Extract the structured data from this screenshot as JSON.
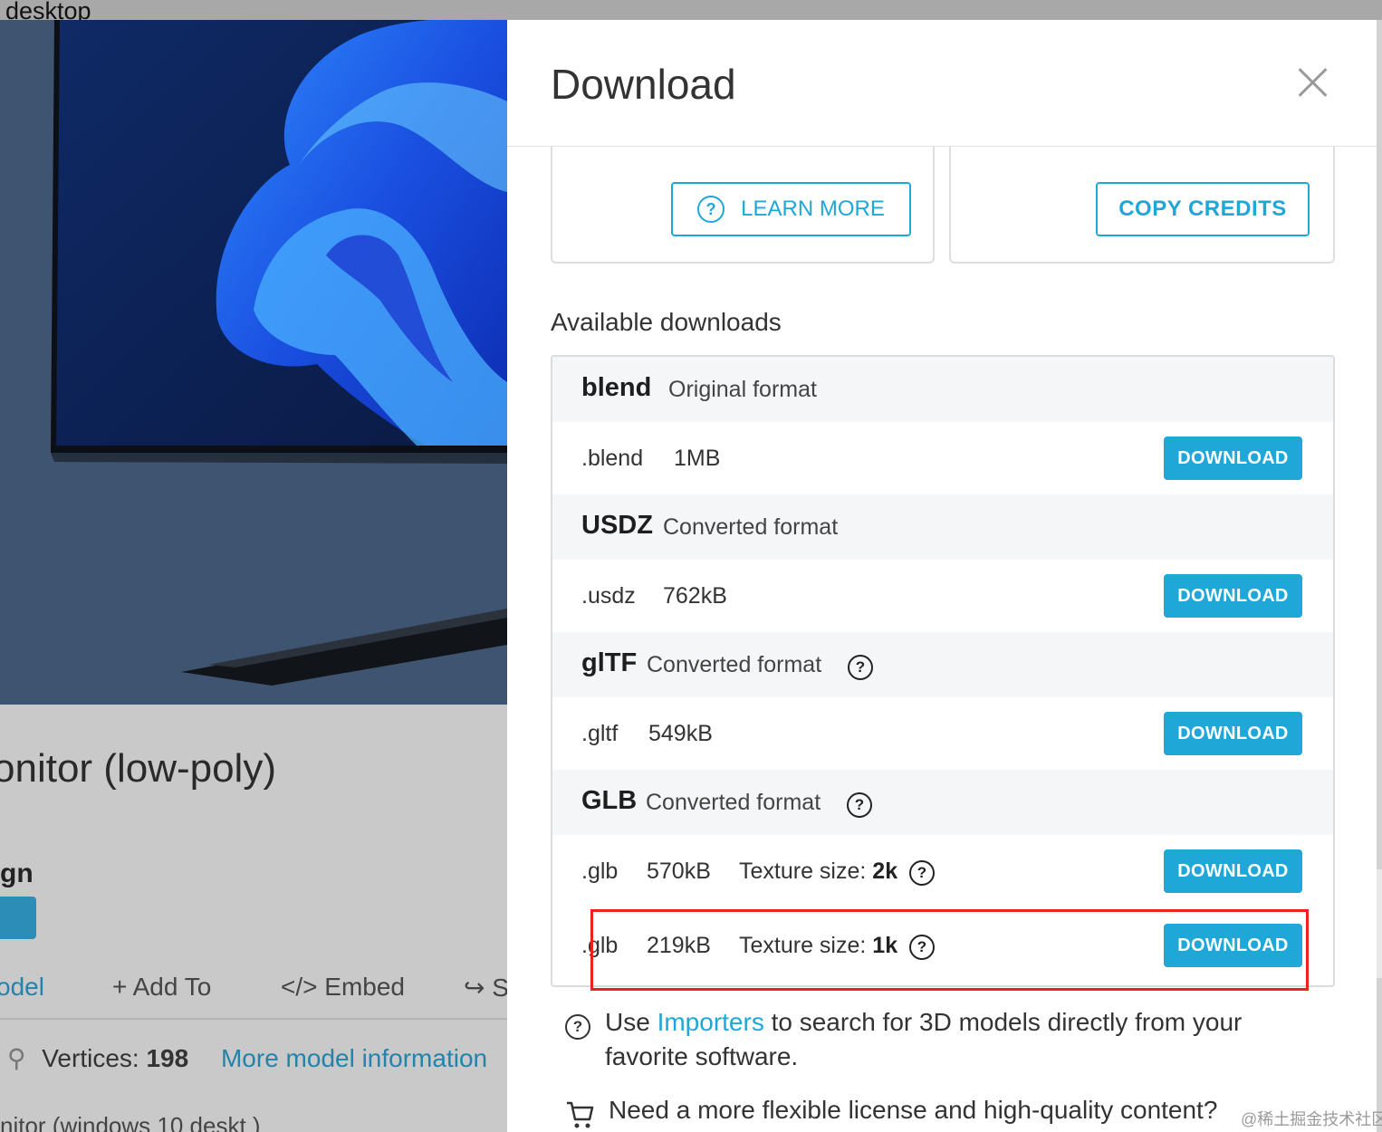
{
  "desktop_label": "desktop",
  "background_page": {
    "title": "onitor (low-poly)",
    "author": "gn",
    "actions": [
      {
        "label": "odel",
        "icon": "model-icon"
      },
      {
        "label": "Add To",
        "icon": "plus-icon"
      },
      {
        "label": "Embed",
        "icon": "code-icon"
      },
      {
        "label": "S",
        "icon": "share-icon"
      }
    ],
    "vertices_label": "Vertices:",
    "vertices_value": "198",
    "more_info_link": "More model information",
    "cut_text": "nitor (windows 10 deskt                )"
  },
  "modal": {
    "title": "Download",
    "learn_more_label": "LEARN MORE",
    "copy_credits_label": "COPY CREDITS",
    "available_title": "Available downloads",
    "formats": [
      {
        "name": "blend",
        "desc": "Original format",
        "has_help": false,
        "files": [
          {
            "ext": ".blend",
            "size": "1MB",
            "texture_label": "",
            "texture_value": "",
            "button": "DOWNLOAD"
          }
        ]
      },
      {
        "name": "USDZ",
        "desc": "Converted format",
        "has_help": false,
        "files": [
          {
            "ext": ".usdz",
            "size": "762kB",
            "texture_label": "",
            "texture_value": "",
            "button": "DOWNLOAD"
          }
        ]
      },
      {
        "name": "glTF",
        "desc": "Converted format",
        "has_help": true,
        "files": [
          {
            "ext": ".gltf",
            "size": "549kB",
            "texture_label": "",
            "texture_value": "",
            "button": "DOWNLOAD"
          }
        ]
      },
      {
        "name": "GLB",
        "desc": "Converted format",
        "has_help": true,
        "files": [
          {
            "ext": ".glb",
            "size": "570kB",
            "texture_label": "Texture size:",
            "texture_value": "2k",
            "button": "DOWNLOAD"
          },
          {
            "ext": ".glb",
            "size": "219kB",
            "texture_label": "Texture size:",
            "texture_value": "1k",
            "button": "DOWNLOAD"
          }
        ]
      }
    ],
    "importers_pre": "Use ",
    "importers_link": "Importers",
    "importers_post": " to search for 3D models directly from your favorite software.",
    "license_text": "Need a more flexible license and high-quality content?"
  },
  "watermark": "@稀土掘金技术社区",
  "colors": {
    "accent": "#1ea7d7",
    "highlight": "#f02020",
    "viewer_bg": "#3e5470"
  }
}
